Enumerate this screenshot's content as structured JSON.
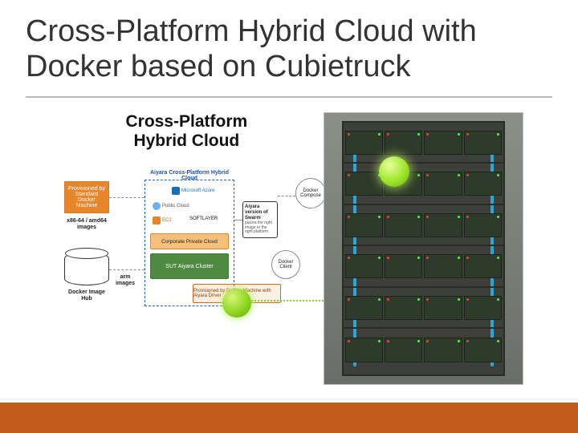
{
  "title": "Cross-Platform Hybrid Cloud with Docker based on Cubietruck",
  "diagram": {
    "heading_line1": "Cross-Platform",
    "heading_line2": "Hybrid Cloud",
    "docker_machine_box": "Provisioned by Standard Docker Machine",
    "x86_label": "x86-64 / amd64 images",
    "hub_label": "Docker Image Hub",
    "arm_label": "arm images",
    "hc_header": "Aiyara Cross-Platform Hybrid Cloud",
    "azure": "Microsoft Azure",
    "public_cloud": "Public Cloud",
    "ec2": "EC2",
    "softlayer": "SOFTLAYER",
    "corporate": "Corporate Private Cloud",
    "sut": "SUT Aiyara Cluster",
    "swarm_title": "Aiyara version of Swarm",
    "swarm_sub": "places the right image to the right platform",
    "compose": "Docker Compose",
    "client": "Docker Client",
    "callout": "Provisioned by Docker Machine with Aiyara Driver"
  },
  "rack": {
    "shelves": 6,
    "boards_per_shelf": 4
  }
}
